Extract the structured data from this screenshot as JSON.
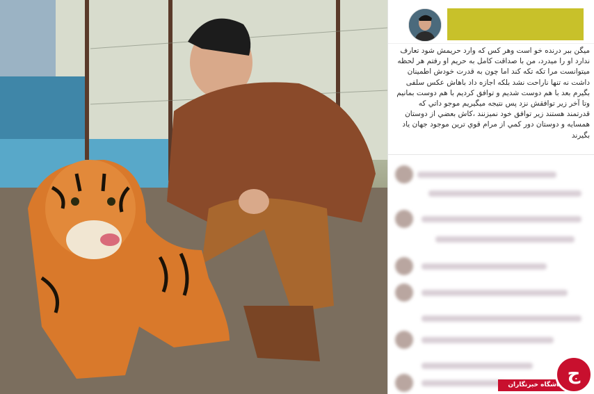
{
  "post": {
    "image_alt": "Man crouching next to a tiger",
    "caption": "میگن ببر درنده خو است وهر کس که وارد حریمش شود تعارف ندارد او را میدرد، من با صداقت کامل به حریم او رفتم هر لحظه میتوانست مرا تکه تکه کند اما چون به قدرت خودش اطمینان داشت نه تنها ناراحت نشد بلکه اجازه داد باهاش عکس سلفی بگیرم بعد با هم دوست شدیم و توافق کردیم با هم دوست بمانیم وتا آخر زیر توافقش نزد پس نتیجه میگیریم موجو داتي که قدرتمند هستند زیر توافق خود نمیزنند ،کاش بعضي از دوستان همسایه و دوستان دور کمي از مرام قوي ترين موجود جهان ياد بگيرند"
  },
  "header": {
    "redacted_color": "#c8c12a"
  },
  "comments": {
    "count_visible": 12,
    "blurred": true
  },
  "watermark": {
    "label": "باشگاه خبرنگاران",
    "mark": "ج",
    "color": "#c8102e"
  }
}
